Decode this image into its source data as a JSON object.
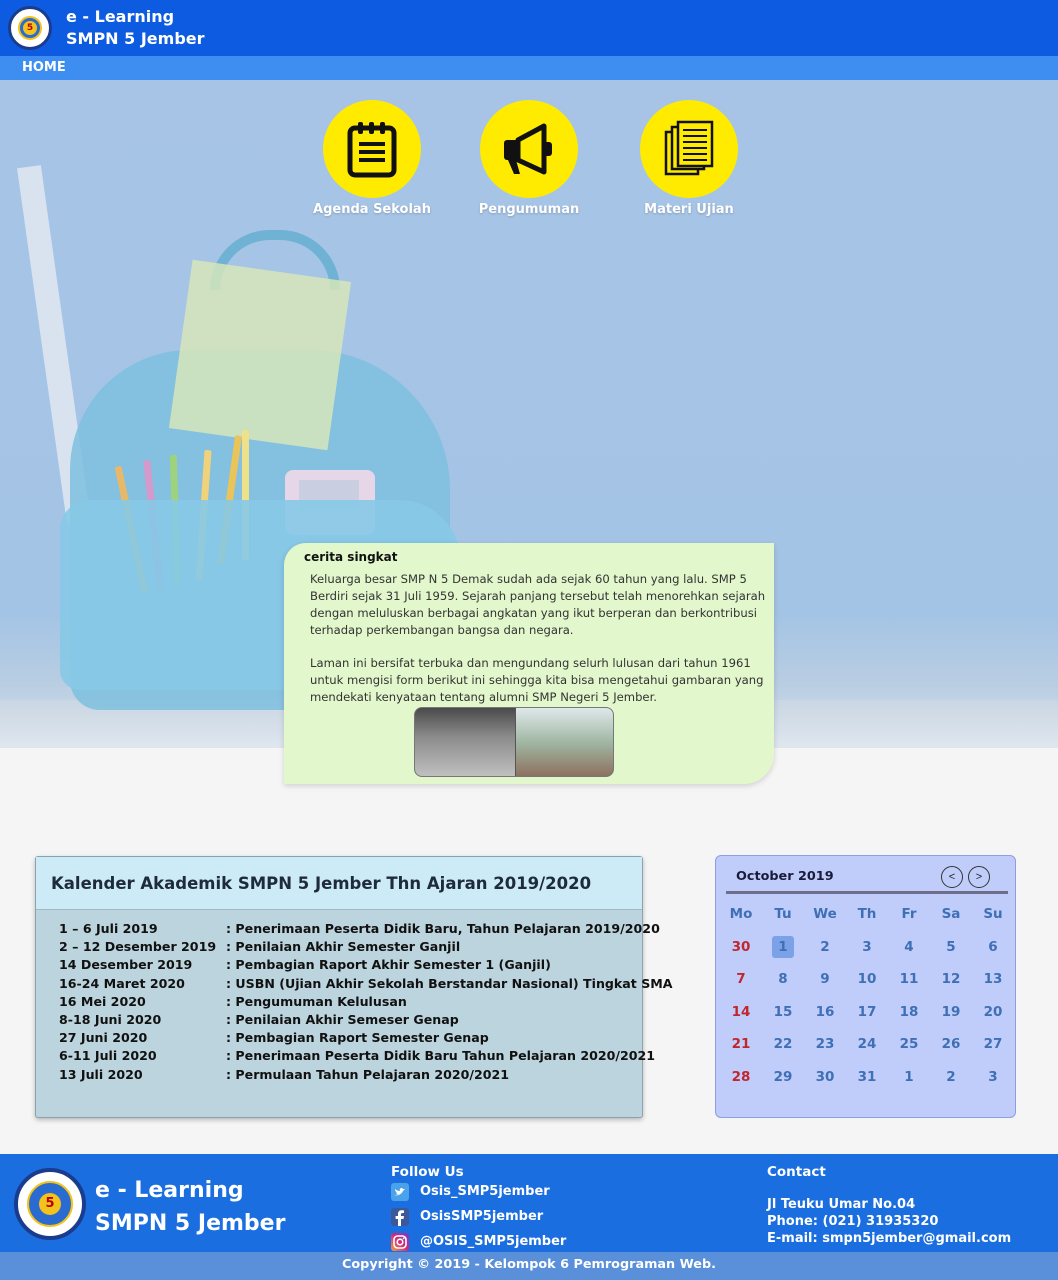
{
  "header": {
    "brand_line1": "e - Learning",
    "brand_line2": "SMPN 5 Jember",
    "logo_number": "5"
  },
  "nav": {
    "home": "HOME"
  },
  "shortcuts": [
    {
      "label": "Agenda Sekolah",
      "icon": "calendar-list-icon"
    },
    {
      "label": "Pengumuman",
      "icon": "megaphone-icon"
    },
    {
      "label": "Materi Ujian",
      "icon": "documents-icon"
    }
  ],
  "story": {
    "title": "cerita singkat",
    "paragraph1": "Keluarga besar SMP N 5 Demak sudah ada sejak 60 tahun yang lalu. SMP 5 Berdiri sejak 31 Juli 1959. Sejarah panjang tersebut telah menorehkan sejarah dengan meluluskan berbagai angkatan yang ikut berperan dan berkontribusi terhadap perkembangan bangsa dan negara.",
    "paragraph2": "Laman ini bersifat terbuka dan mengundang selurh lulusan dari tahun 1961 untuk mengisi form berikut ini sehingga kita bisa mengetahui gambaran yang mendekati kenyataan tentang alumni SMP Negeri 5 Jember."
  },
  "academic_calendar": {
    "title": "Kalender Akademik SMPN 5 Jember Thn Ajaran 2019/2020",
    "events": [
      {
        "date": "1 – 6 Juli 2019",
        "event": ": Penerimaan Peserta Didik Baru, Tahun Pelajaran 2019/2020"
      },
      {
        "date": "2 – 12 Desember 2019",
        "event": ": Penilaian Akhir Semester Ganjil"
      },
      {
        "date": "14 Desember 2019",
        "event": ": Pembagian Raport Akhir Semester 1 (Ganjil)"
      },
      {
        "date": "16-24 Maret 2020",
        "event": ": USBN (Ujian Akhir Sekolah Berstandar Nasional) Tingkat SMA"
      },
      {
        "date": "16 Mei 2020",
        "event": ": Pengumuman Kelulusan"
      },
      {
        "date": "8-18 Juni 2020",
        "event": ": Penilaian Akhir Semeser Genap"
      },
      {
        "date": "27 Juni 2020",
        "event": ": Pembagian Raport Semester Genap"
      },
      {
        "date": "6-11 Juli 2020",
        "event": ": Penerimaan Peserta Didik Baru Tahun Pelajaran 2020/2021"
      },
      {
        "date": "13 Juli 2020",
        "event": ": Permulaan Tahun Pelajaran 2020/2021"
      }
    ]
  },
  "calendar": {
    "month_label": "October 2019",
    "prev": "<",
    "next": ">",
    "weekdays": [
      "Mo",
      "Tu",
      "We",
      "Th",
      "Fr",
      "Sa",
      "Su"
    ],
    "weeks": [
      [
        "30",
        "1",
        "2",
        "3",
        "4",
        "5",
        "6"
      ],
      [
        "7",
        "8",
        "9",
        "10",
        "11",
        "12",
        "13"
      ],
      [
        "14",
        "15",
        "16",
        "17",
        "18",
        "19",
        "20"
      ],
      [
        "21",
        "22",
        "23",
        "24",
        "25",
        "26",
        "27"
      ],
      [
        "28",
        "29",
        "30",
        "31",
        "1",
        "2",
        "3"
      ]
    ],
    "highlighted_day": "1",
    "colors": {
      "day": "#3f6fb5",
      "first_column": "#c0262e",
      "highlight": "#7ba1e6"
    }
  },
  "footer": {
    "brand_line1": "e - Learning",
    "brand_line2": "SMPN 5 Jember",
    "follow_title": "Follow Us",
    "socials": [
      {
        "icon": "twitter-icon",
        "handle": "Osis_SMP5jember"
      },
      {
        "icon": "facebook-icon",
        "handle": "OsisSMP5jember"
      },
      {
        "icon": "instagram-icon",
        "handle": "@OSIS_SMP5jember"
      }
    ],
    "contact_title": "Contact",
    "address": "Jl Teuku Umar No.04",
    "phone": "Phone: (021) 31935320",
    "email": "E-mail: smpn5jember@gmail.com",
    "copyright": "Copyright © 2019 - Kelompok 6 Pemrograman Web."
  },
  "colors": {
    "header": "#0d5be0",
    "nav": "#3d8ef0",
    "shortcut": "#ffeb00",
    "footer": "#1b6ee0"
  }
}
